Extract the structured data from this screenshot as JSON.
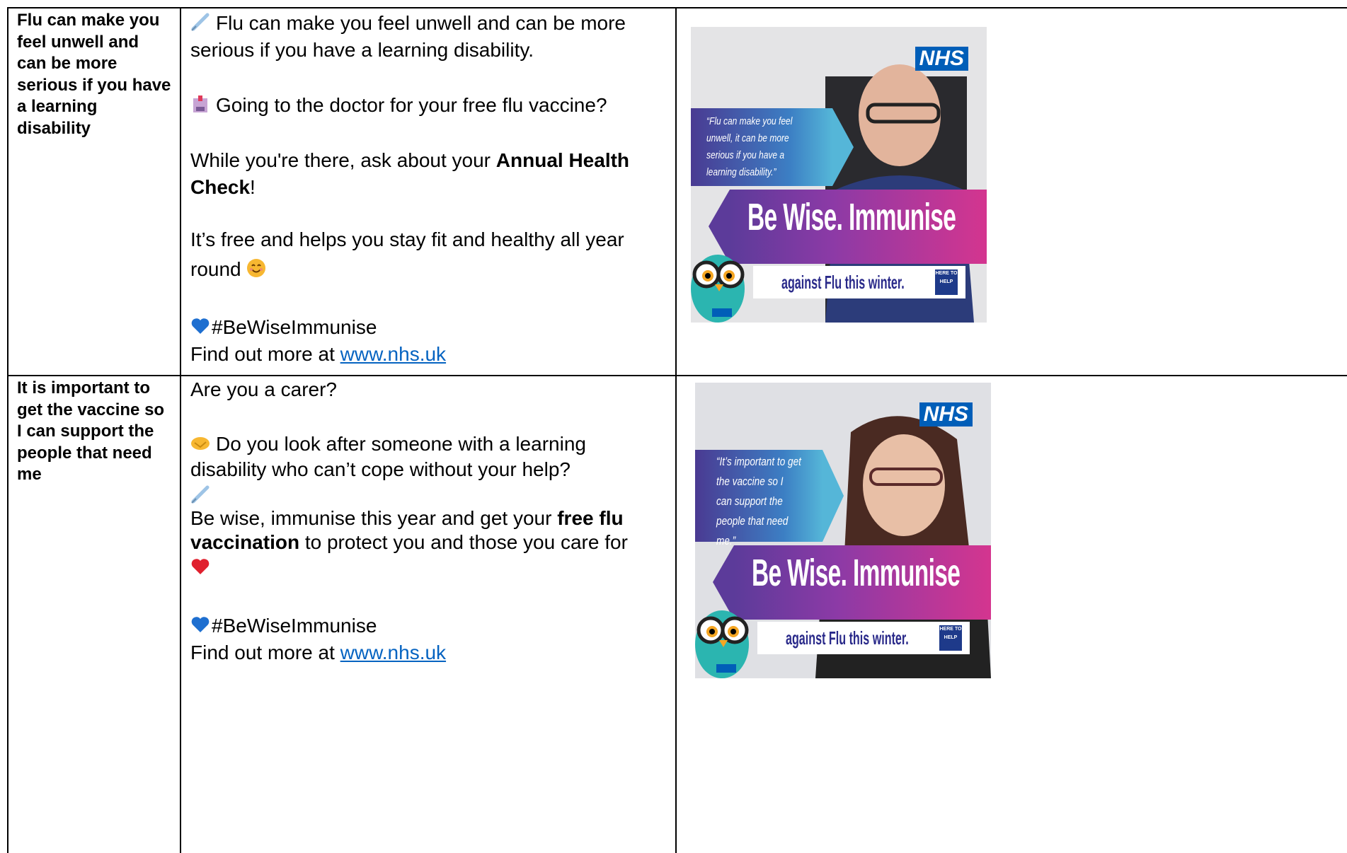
{
  "rows": [
    {
      "heading": "Flu can make you feel unwell and can be more serious if you have a learning disability",
      "paragraphs": {
        "p1": "Flu can make you feel unwell and can be more serious if you have a learning disability.",
        "p2": "Going to the doctor for your free flu vaccine?",
        "p3_pre": "While you're there, ask about your ",
        "p3_bold": "Annual Health Check",
        "p3_post": "!",
        "p4": "It’s free and helps you stay fit and healthy all year round",
        "hashtag": "#BeWiseImmunise",
        "find_more": "Find out more at ",
        "link": "www.nhs.uk"
      },
      "poster": {
        "nhs": "NHS",
        "quote": "“Flu can make you feel unwell, it can be more serious if you have a learning disability.”",
        "slogan": "Be Wise. Immunise",
        "tagline": "against Flu this winter.",
        "badge": "HERE TO HELP"
      }
    },
    {
      "heading": "It is important to get the vaccine so I can support the people that need me",
      "paragraphs": {
        "p1": "Are you a carer?",
        "p2": "Do you look after someone with a learning disability who can’t cope without your help?",
        "p3_pre": " Be wise, immunise this year and get your ",
        "p3_bold": "free flu vaccination",
        "p3_post": " to protect you and those you care for",
        "hashtag": "#BeWiseImmunise",
        "find_more": "Find out more at ",
        "link": "www.nhs.uk"
      },
      "poster": {
        "nhs": "NHS",
        "quote": "“It’s important to get the vaccine so I can support the people that need me.”",
        "slogan": "Be Wise. Immunise",
        "tagline": "against Flu this winter.",
        "badge": "HERE TO HELP"
      }
    }
  ]
}
